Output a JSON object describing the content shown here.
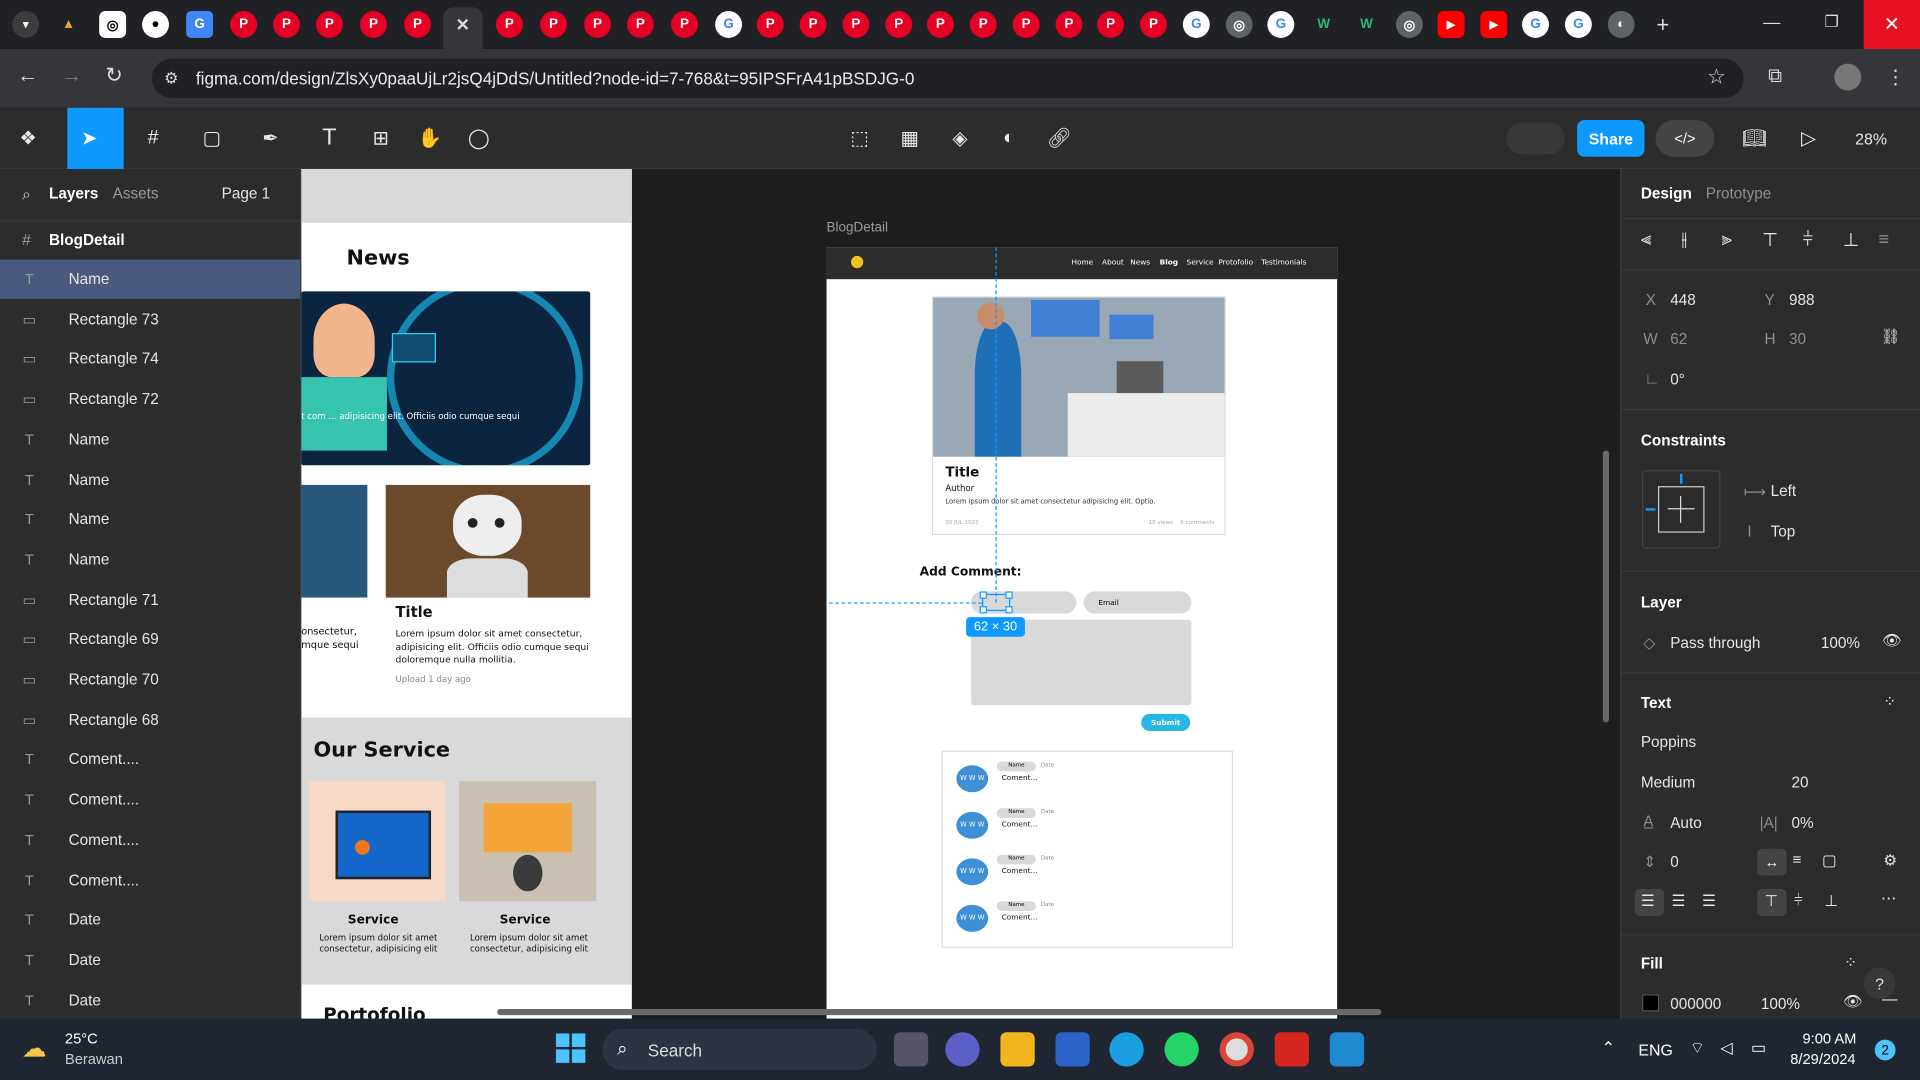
{
  "browser": {
    "url": "figma.com/design/ZlsXy0paaUjLr2jsQ4jDdS/Untitled?node-id=7-768&t=95IPSFrA41pBSDJG-0"
  },
  "toolbar": {
    "share_label": "Share",
    "zoom": "28%"
  },
  "left_panel": {
    "tabs": [
      "Layers",
      "Assets"
    ],
    "page": "Page 1",
    "frame": "BlogDetail",
    "layers": [
      {
        "type": "text",
        "name": "Name"
      },
      {
        "type": "rect",
        "name": "Rectangle 73"
      },
      {
        "type": "rect",
        "name": "Rectangle 74"
      },
      {
        "type": "rect",
        "name": "Rectangle 72"
      },
      {
        "type": "text",
        "name": "Name"
      },
      {
        "type": "text",
        "name": "Name"
      },
      {
        "type": "text",
        "name": "Name"
      },
      {
        "type": "text",
        "name": "Name"
      },
      {
        "type": "rect",
        "name": "Rectangle 71"
      },
      {
        "type": "rect",
        "name": "Rectangle 69"
      },
      {
        "type": "rect",
        "name": "Rectangle 70"
      },
      {
        "type": "rect",
        "name": "Rectangle 68"
      },
      {
        "type": "text",
        "name": "Coment...."
      },
      {
        "type": "text",
        "name": "Coment...."
      },
      {
        "type": "text",
        "name": "Coment...."
      },
      {
        "type": "text",
        "name": "Coment...."
      },
      {
        "type": "text",
        "name": "Date"
      },
      {
        "type": "text",
        "name": "Date"
      },
      {
        "type": "text",
        "name": "Date"
      }
    ]
  },
  "canvas": {
    "frame_label": "BlogDetail",
    "size_badge": "62 × 30",
    "left_page": {
      "news_heading": "News",
      "news_overlay": "t com ... adipisicing elit. Officiis odio cumque sequi",
      "card_title": "Title",
      "card_body": "Lorem ipsum dolor sit amet consectetur, adipisicing elit. Officiis odio cumque sequi doloremque nulla mollitia.",
      "card_meta": "Upload 1 day ago",
      "left_snip_1": "onsectetur,",
      "left_snip_2": "mque sequi",
      "service_heading": "Our Service",
      "services": [
        {
          "title": "Service",
          "body": "Lorem ipsum dolor sit amet consectetur, adipisicing elit"
        },
        {
          "title": "Service",
          "body": "Lorem ipsum dolor sit amet consectetur, adipisicing elit"
        }
      ],
      "portfolio_heading": "Portofolio"
    },
    "blog": {
      "nav": [
        "Home",
        "About",
        "News",
        "Blog",
        "Service",
        "Protofolio",
        "Testimonials"
      ],
      "active_nav": "Blog",
      "post_title": "Title",
      "post_author": "Author",
      "post_body": "Lorem ipsum dolor sit amet consectetur adipisicing elit. Optio.",
      "post_date": "30 JUL 2023",
      "post_views": "10 views",
      "post_comments": "6 comments",
      "add_comment": "Add Comment:",
      "email_placeholder": "Email",
      "submit": "Submit",
      "comments": [
        {
          "avatar": "W W W",
          "name": "Name",
          "date": "Date",
          "text": "Coment..."
        },
        {
          "avatar": "W W W",
          "name": "Name",
          "date": "Date",
          "text": "Coment..."
        },
        {
          "avatar": "W W W",
          "name": "Name",
          "date": "Date",
          "text": "Coment..."
        },
        {
          "avatar": "W W W",
          "name": "Name",
          "date": "Date",
          "text": "Coment..."
        }
      ]
    }
  },
  "right_panel": {
    "tabs": [
      "Design",
      "Prototype"
    ],
    "x_label": "X",
    "x": "448",
    "y_label": "Y",
    "y": "988",
    "w_label": "W",
    "w": "62",
    "h_label": "H",
    "h": "30",
    "rotation": "0°",
    "constraints_title": "Constraints",
    "constraint_h": "Left",
    "constraint_v": "Top",
    "layer_title": "Layer",
    "blend": "Pass through",
    "opacity": "100%",
    "text_title": "Text",
    "font": "Poppins",
    "weight": "Medium",
    "size": "20",
    "line_height": "Auto",
    "letter_spacing": "0%",
    "para_spacing": "0",
    "fill_title": "Fill",
    "fill_hex": "000000",
    "fill_opacity": "100%",
    "fill_color": "#000000"
  },
  "taskbar": {
    "temp": "25°C",
    "weather": "Berawan",
    "search": "Search",
    "lang": "ENG",
    "time": "9:00 AM",
    "date": "8/29/2024",
    "notif": "2"
  }
}
